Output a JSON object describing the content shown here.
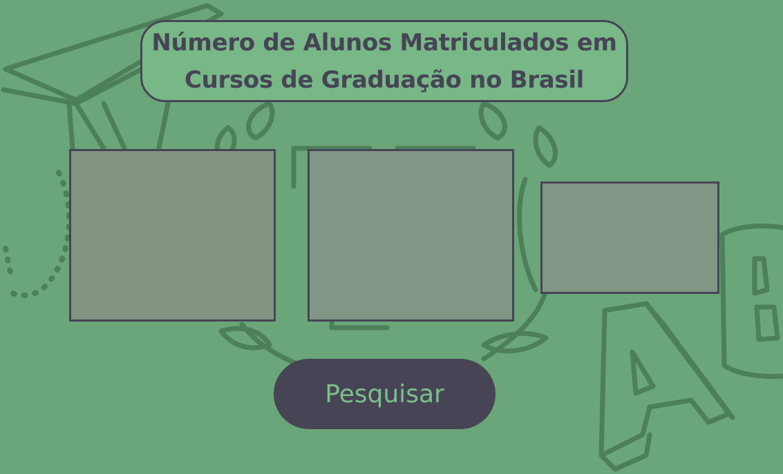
{
  "title": {
    "line1": "Número de Alunos Matriculados em",
    "line2": "Cursos de Graduação no Brasil"
  },
  "panels": [
    {
      "id": "panel-1"
    },
    {
      "id": "panel-2"
    },
    {
      "id": "panel-3"
    }
  ],
  "search_button": {
    "label": "Pesquisar"
  },
  "colors": {
    "background": "#6aa679",
    "title_fill": "#77b886",
    "dark": "#474456",
    "panel_fill": "#819684",
    "button_text": "#79c18a",
    "doodle_stroke": "#4a7b55"
  },
  "decorations": [
    "graduation-cap-doodle",
    "laurel-wreath-doodle",
    "letter-blocks-doodle",
    "dotted-arc-doodle"
  ]
}
